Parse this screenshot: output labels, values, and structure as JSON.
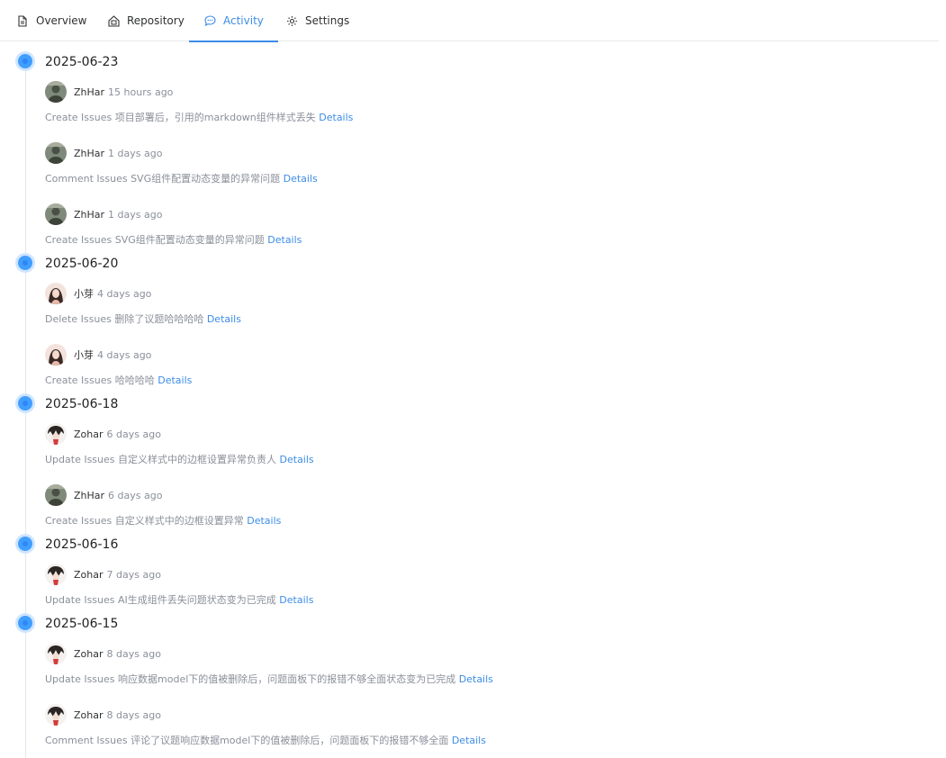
{
  "tabs": [
    {
      "label": "Overview",
      "icon": "document-icon"
    },
    {
      "label": "Repository",
      "icon": "repository-icon"
    },
    {
      "label": "Activity",
      "icon": "comment-icon",
      "active": true
    },
    {
      "label": "Settings",
      "icon": "gear-icon"
    }
  ],
  "colors": {
    "accent": "#3c8ce7",
    "dot": "#409eff",
    "muted": "#8a8f99"
  },
  "groups": [
    {
      "date": "2025-06-23",
      "entries": [
        {
          "user": "ZhHar",
          "time": "15 hours ago",
          "action": "Create Issues",
          "text": "项目部署后，引用的markdown组件样式丢失",
          "link": "Details"
        },
        {
          "user": "ZhHar",
          "time": "1 days ago",
          "action": "Comment Issues",
          "text": "SVG组件配置动态变量的异常问题",
          "link": "Details"
        },
        {
          "user": "ZhHar",
          "time": "1 days ago",
          "action": "Create Issues",
          "text": "SVG组件配置动态变量的异常问题",
          "link": "Details"
        }
      ]
    },
    {
      "date": "2025-06-20",
      "entries": [
        {
          "user": "小芽",
          "time": "4 days ago",
          "action": "Delete Issues",
          "text": "删除了议题哈哈哈哈",
          "link": "Details"
        },
        {
          "user": "小芽",
          "time": "4 days ago",
          "action": "Create Issues",
          "text": "哈哈哈哈",
          "link": "Details"
        }
      ]
    },
    {
      "date": "2025-06-18",
      "entries": [
        {
          "user": "Zohar",
          "time": "6 days ago",
          "action": "Update Issues",
          "text": "自定义样式中的边框设置异常负责人",
          "link": "Details"
        },
        {
          "user": "ZhHar",
          "time": "6 days ago",
          "action": "Create Issues",
          "text": "自定义样式中的边框设置异常",
          "link": "Details"
        }
      ]
    },
    {
      "date": "2025-06-16",
      "entries": [
        {
          "user": "Zohar",
          "time": "7 days ago",
          "action": "Update Issues",
          "text": "AI生成组件丢失问题状态变为已完成",
          "link": "Details"
        }
      ]
    },
    {
      "date": "2025-06-15",
      "entries": [
        {
          "user": "Zohar",
          "time": "8 days ago",
          "action": "Update Issues",
          "text": "响应数据model下的值被删除后，问题面板下的报错不够全面状态变为已完成",
          "link": "Details"
        },
        {
          "user": "Zohar",
          "time": "8 days ago",
          "action": "Comment Issues",
          "text": "评论了议题响应数据model下的值被删除后，问题面板下的报错不够全面",
          "link": "Details"
        }
      ]
    }
  ]
}
